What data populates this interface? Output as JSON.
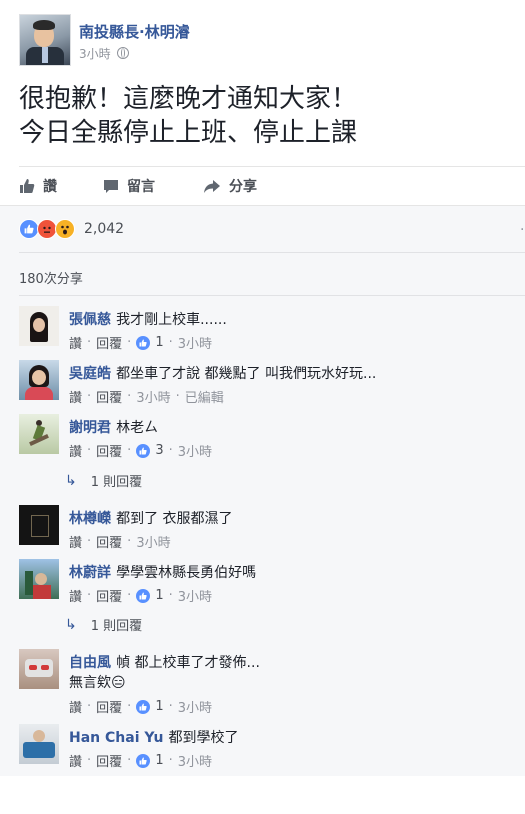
{
  "post": {
    "page_name": "南投縣長·林明濬",
    "time": "3小時",
    "lines": [
      "很抱歉！這麼晚才通知大家！",
      "今日全縣停止上班、停止上課"
    ],
    "actions": {
      "like": "讚",
      "comment": "留言",
      "share": "分享"
    },
    "reaction_count": "2,042",
    "share_count": "180次分享",
    "reaction_icons": [
      "like-icon",
      "angry-icon",
      "wow-icon"
    ]
  },
  "colors": {
    "link": "#365899",
    "like_blue": "#5890ff",
    "angry": "#f0533a",
    "wow": "#f7b125"
  },
  "comment_labels": {
    "like": "讚",
    "reply": "回覆"
  },
  "comments": [
    {
      "name": "張佩慈",
      "text": "我才剛上校車......",
      "likes": "1",
      "time": "3小時",
      "edited": "",
      "replies": ""
    },
    {
      "name": "吳庭皓",
      "text": "都坐車了才說 都幾點了 叫我們玩水好玩...",
      "likes": "",
      "time": "3小時",
      "edited": "已編輯",
      "replies": ""
    },
    {
      "name": "謝明君",
      "text": "林老ㄙ",
      "likes": "3",
      "time": "3小時",
      "edited": "",
      "replies": "1 則回覆"
    },
    {
      "name": "林樽嶸",
      "text": "都到了 衣服都濕了",
      "likes": "",
      "time": "3小時",
      "edited": "",
      "replies": ""
    },
    {
      "name": "林蔚詳",
      "text": "學學雲林縣長勇伯好嗎",
      "likes": "1",
      "time": "3小時",
      "edited": "",
      "replies": "1 則回覆"
    },
    {
      "name": "自由風",
      "text": "幀 都上校車了才發佈...",
      "text2": "無言欸😑",
      "likes": "1",
      "time": "3小時",
      "edited": "",
      "replies": ""
    },
    {
      "name": "Han Chai Yu",
      "text": "都到學校了",
      "likes": "1",
      "time": "3小時",
      "edited": "",
      "replies": ""
    }
  ]
}
